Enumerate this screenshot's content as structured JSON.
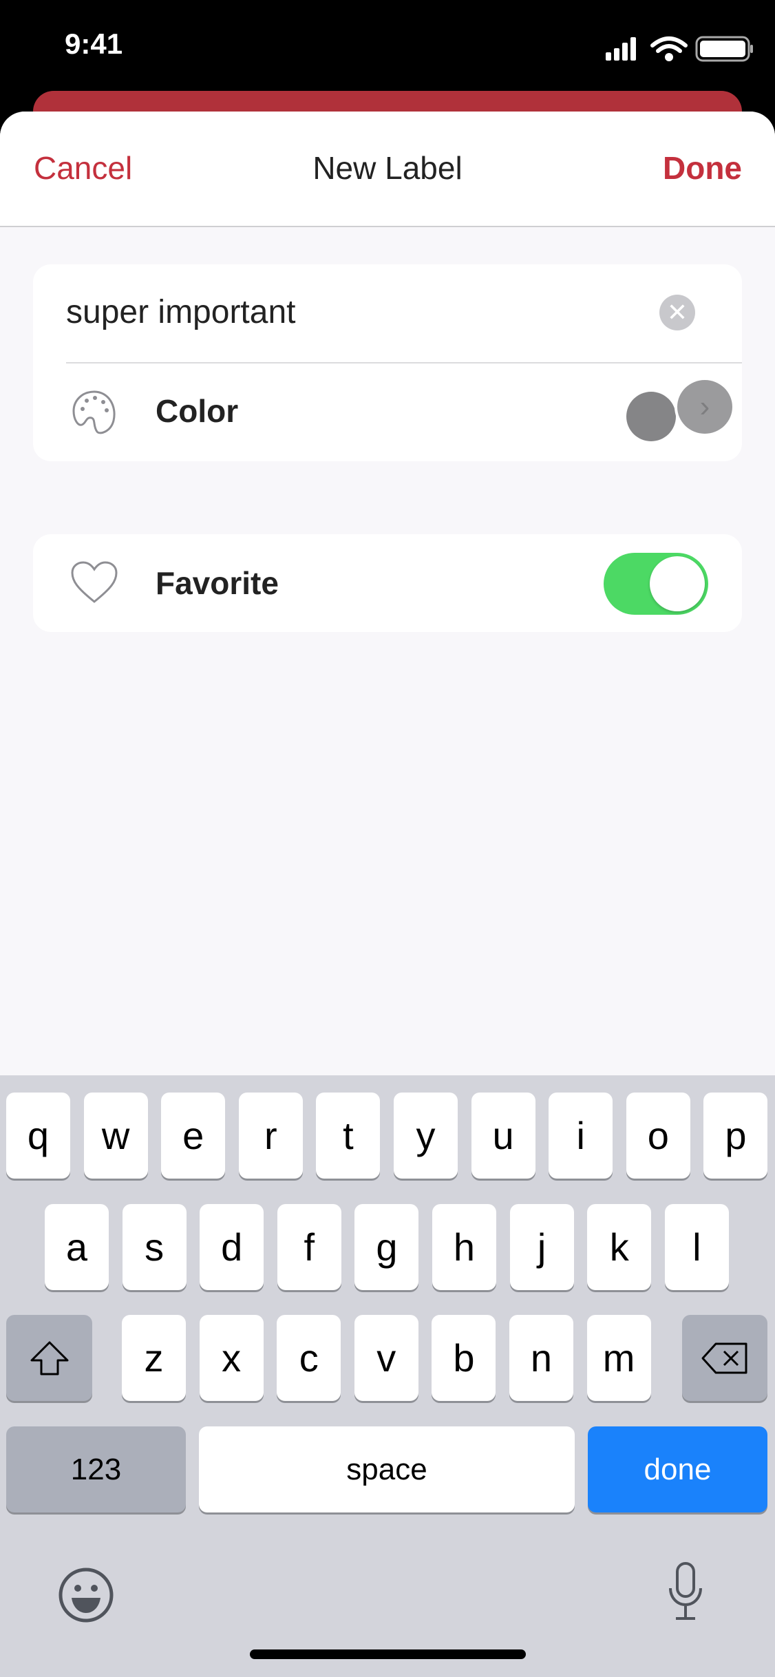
{
  "status_bar": {
    "time": "9:41",
    "icons": [
      "cellular-signal-icon",
      "wifi-icon",
      "battery-icon"
    ]
  },
  "nav": {
    "cancel": "Cancel",
    "title": "New Label",
    "done": "Done"
  },
  "form": {
    "name_value": "super important",
    "color_label": "Color",
    "favorite_label": "Favorite",
    "favorite_on": true
  },
  "colors": {
    "accent": "#c4303d",
    "toggle_on": "#4cd964",
    "keyboard_done": "#1a82fb"
  },
  "keyboard": {
    "row1": [
      "q",
      "w",
      "e",
      "r",
      "t",
      "y",
      "u",
      "i",
      "o",
      "p"
    ],
    "row2": [
      "a",
      "s",
      "d",
      "f",
      "g",
      "h",
      "j",
      "k",
      "l"
    ],
    "row3": [
      "z",
      "x",
      "c",
      "v",
      "b",
      "n",
      "m"
    ],
    "numbers": "123",
    "space": "space",
    "done": "done"
  }
}
